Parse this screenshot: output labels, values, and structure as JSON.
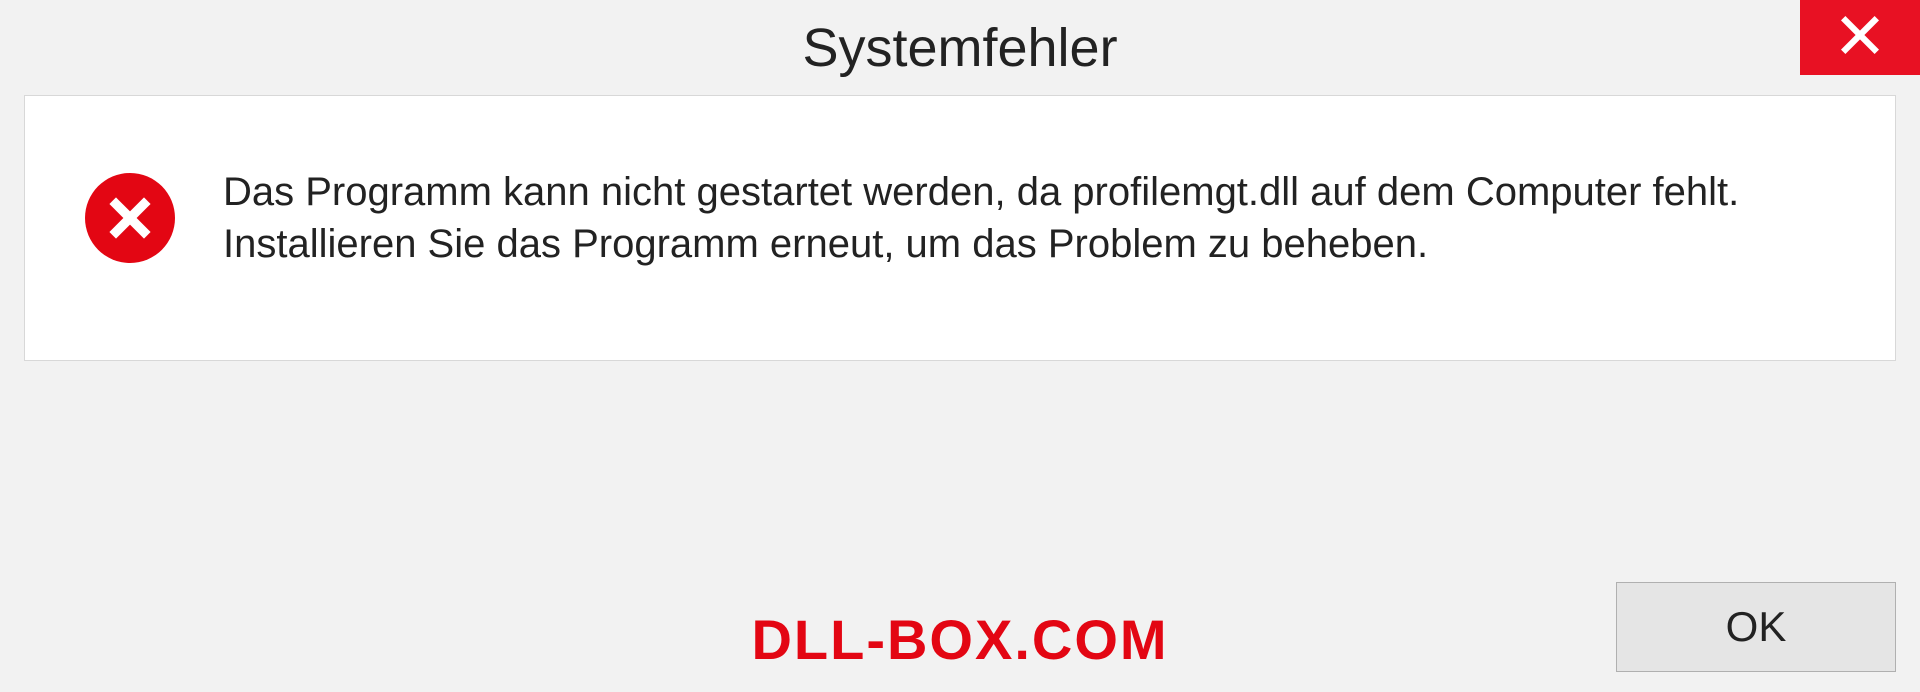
{
  "dialog": {
    "title": "Systemfehler",
    "message": "Das Programm kann nicht gestartet werden, da profilemgt.dll auf dem Computer fehlt. Installieren Sie das Programm erneut, um das Problem zu beheben.",
    "ok_label": "OK"
  },
  "brand": "DLL-BOX.COM",
  "icons": {
    "close": "close-icon",
    "error": "error-circle-icon"
  },
  "colors": {
    "title_bg": "#f2f2f2",
    "close_bg": "#e81123",
    "error_red": "#e30613",
    "panel_bg": "#ffffff",
    "dialog_bg": "#f2f2f2"
  }
}
